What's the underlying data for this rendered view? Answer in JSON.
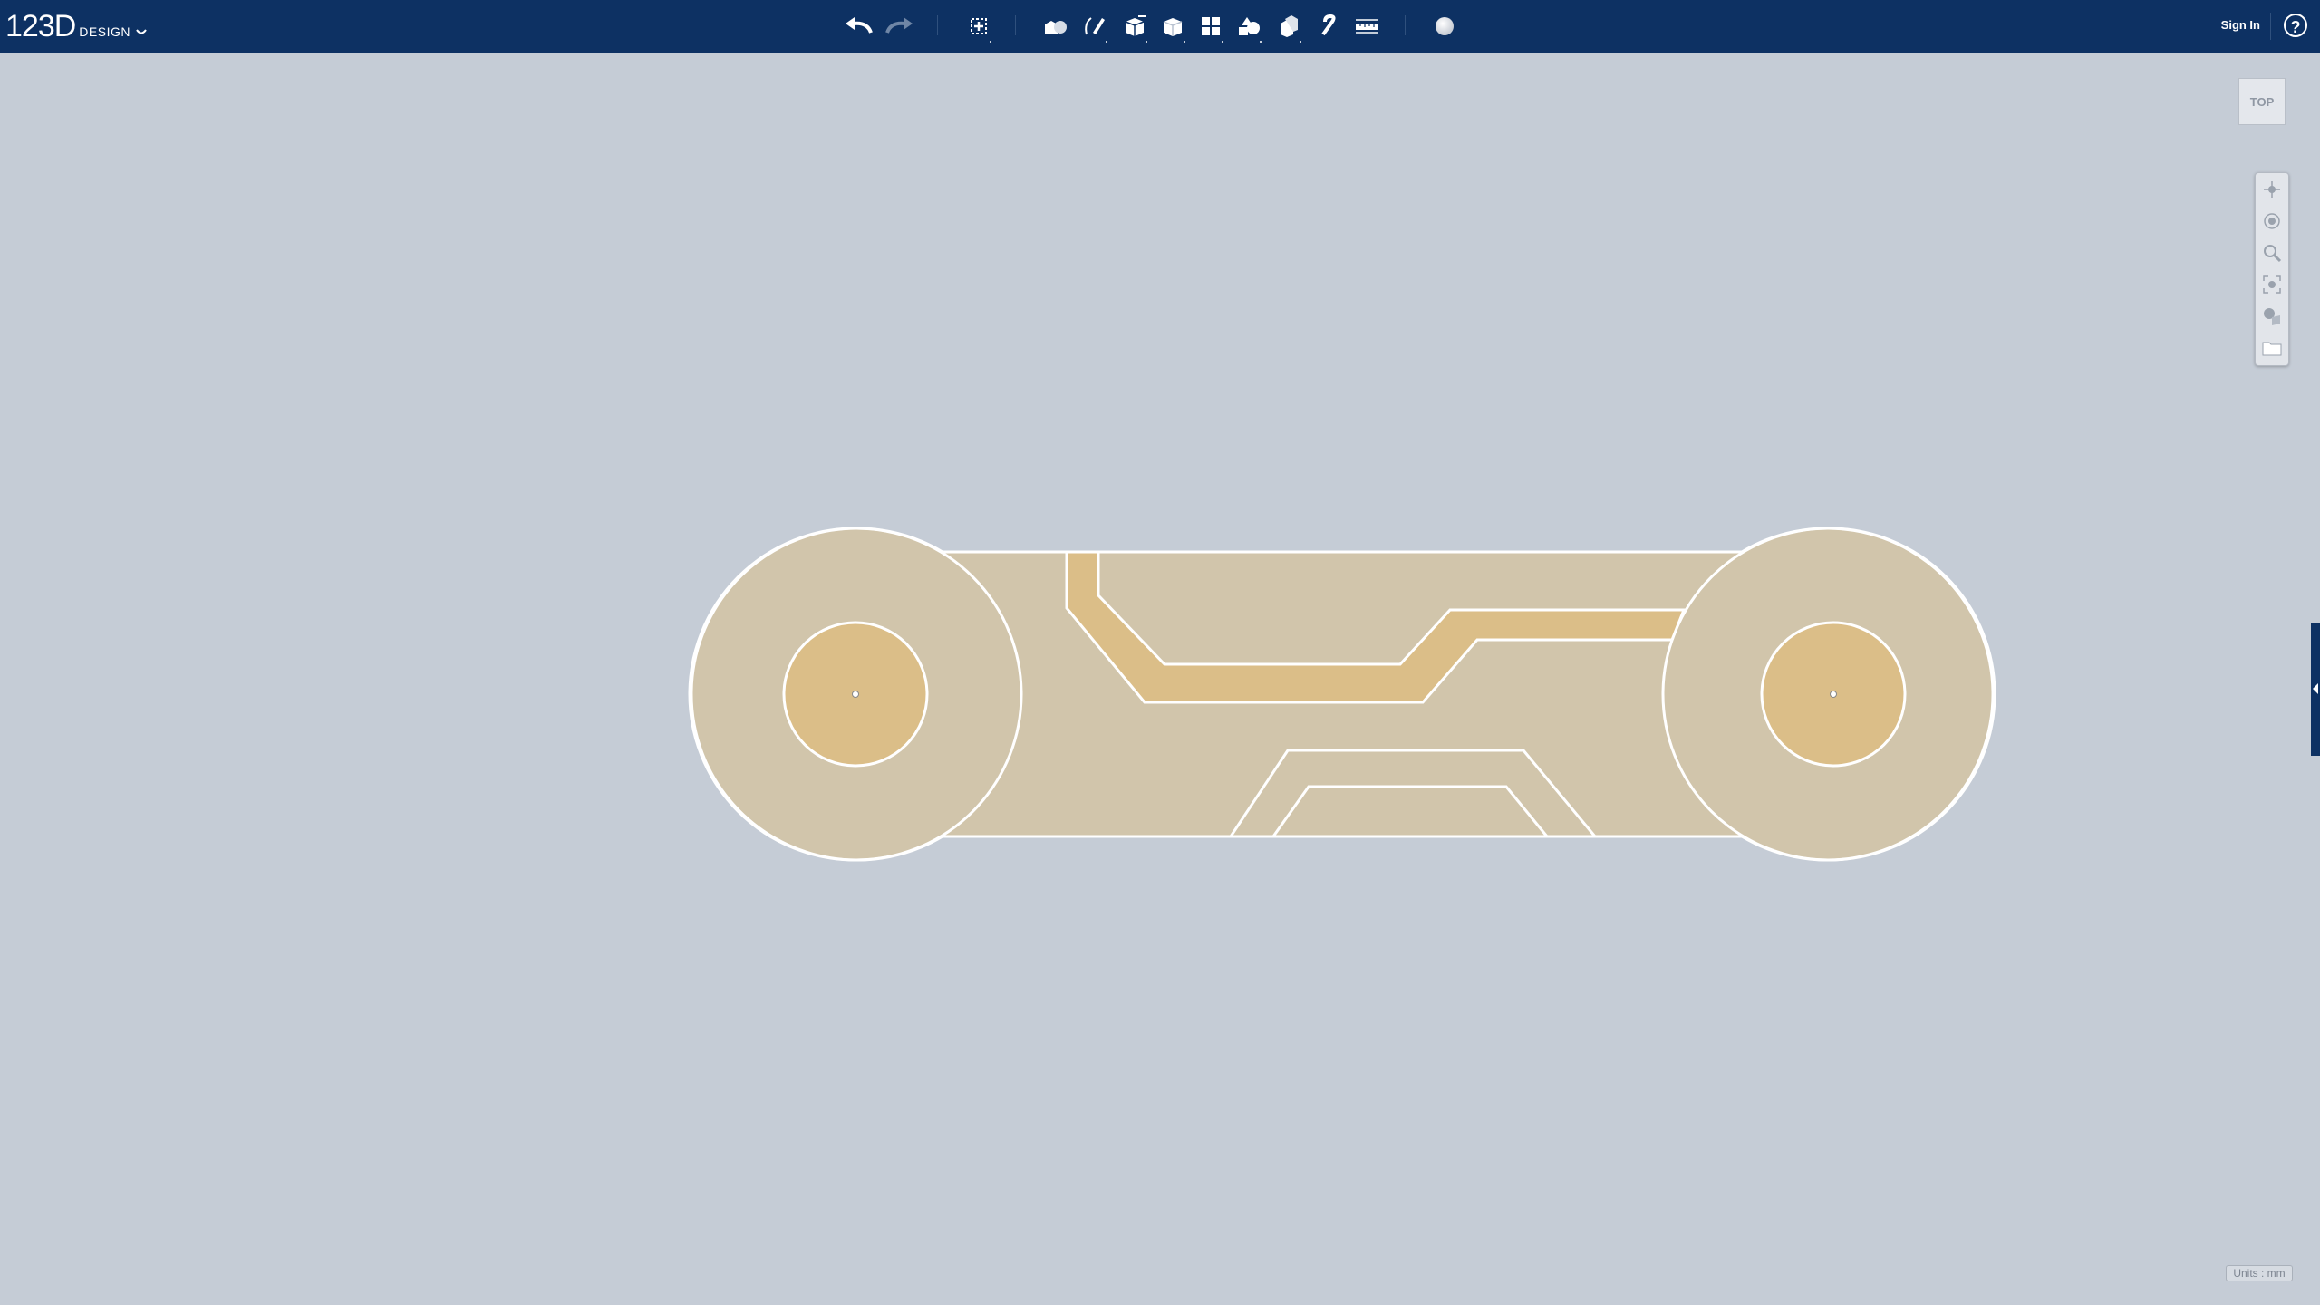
{
  "app": {
    "logo_main": "123D",
    "logo_sub": "DESIGN",
    "logo_menu_icon": "chevron-down-icon"
  },
  "toolbar": {
    "tools": [
      {
        "name": "undo",
        "icon": "undo-arrow-icon"
      },
      {
        "name": "redo",
        "icon": "redo-arrow-icon"
      },
      {
        "name": "transform",
        "icon": "transform-move-icon"
      },
      {
        "name": "primitives",
        "icon": "primitive-shapes-icon"
      },
      {
        "name": "sketch",
        "icon": "sketch-pencil-icon"
      },
      {
        "name": "construct",
        "icon": "construct-box-icon"
      },
      {
        "name": "modify",
        "icon": "modify-cube-icon"
      },
      {
        "name": "pattern",
        "icon": "pattern-grid-icon"
      },
      {
        "name": "grouping",
        "icon": "grouping-icon"
      },
      {
        "name": "combine",
        "icon": "combine-icon"
      },
      {
        "name": "snap",
        "icon": "snap-magnet-icon"
      },
      {
        "name": "measure",
        "icon": "measure-ruler-icon"
      },
      {
        "name": "material",
        "icon": "material-sphere-icon"
      }
    ]
  },
  "header": {
    "sign_in": "Sign In",
    "help": "?"
  },
  "viewcube": {
    "face_label": "TOP"
  },
  "nav": {
    "buttons": [
      "pan-icon",
      "orbit-icon",
      "zoom-icon",
      "fit-view-icon",
      "visual-style-icon",
      "materials-panel-icon"
    ]
  },
  "status": {
    "units": "Units : mm"
  },
  "colors": {
    "topbar": "#0d3163",
    "viewport": "#c5ccd6",
    "part_fill": "#d1c5ab",
    "highlight_fill": "#dbbe88",
    "edge": "#ffffff"
  }
}
